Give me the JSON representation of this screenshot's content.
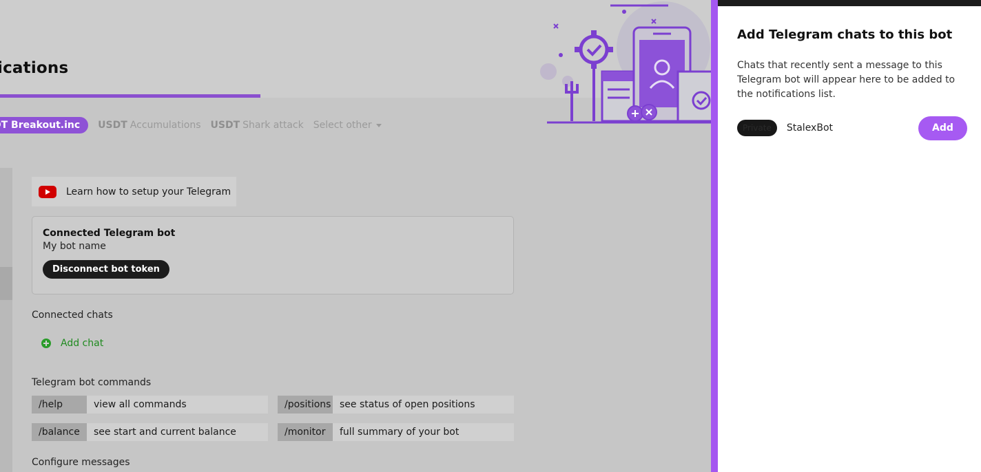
{
  "page": {
    "title": "ications",
    "tabs": {
      "active": "DT Breakout.inc",
      "items": [
        {
          "prefix": "USDT",
          "label": "Accumulations"
        },
        {
          "prefix": "USDT",
          "label": "Shark attack"
        }
      ],
      "select_other": "Select other"
    },
    "video_link": "Learn how to setup your Telegram",
    "bot_card": {
      "title": "Connected Telegram bot",
      "bot_name": "My bot name",
      "disconnect_label": "Disconnect bot token"
    },
    "connected_chats_label": "Connected chats",
    "add_chat_label": "Add chat",
    "commands_label": "Telegram bot commands",
    "commands": [
      {
        "key": "/help",
        "desc": "view all commands"
      },
      {
        "key": "/positions",
        "desc": "see status of open positions"
      },
      {
        "key": "/balance",
        "desc": "see start and current balance"
      },
      {
        "key": "/monitor",
        "desc": "full summary of your bot"
      }
    ],
    "configure_label": "Configure messages"
  },
  "panel": {
    "title": "Add Telegram chats to this bot",
    "description": "Chats that recently sent a message to this Telegram bot will appear here to be added to the notifications list.",
    "chats": [
      {
        "type": "Private",
        "name": "StalexBot",
        "action": "Add"
      }
    ]
  },
  "colors": {
    "accent": "#a457f0",
    "accent_dim": "#8e52d6",
    "success": "#2a9c2a",
    "youtube": "#d10000"
  }
}
